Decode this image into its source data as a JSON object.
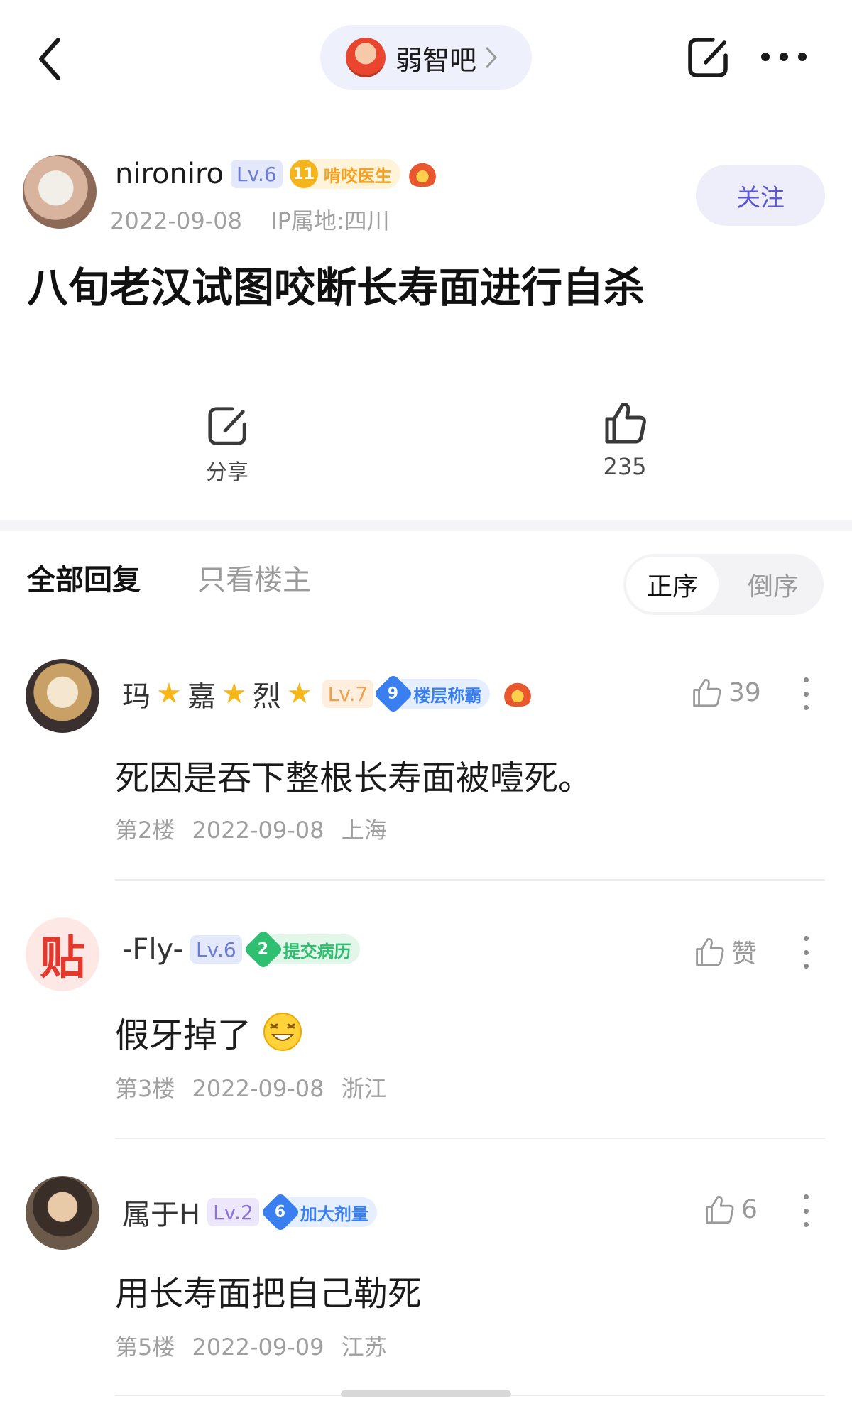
{
  "header": {
    "forum_name": "弱智吧"
  },
  "post": {
    "author": {
      "name": "nironiro",
      "level": "Lv.6",
      "title_badge_num": "11",
      "title_badge": "啃咬医生",
      "date": "2022-09-08",
      "ip_location": "IP属地:四川"
    },
    "follow_label": "关注",
    "title": "八旬老汉试图咬断长寿面进行自杀",
    "share_label": "分享",
    "like_count": "235"
  },
  "tabs": {
    "all_replies": "全部回复",
    "op_only": "只看楼主"
  },
  "sort": {
    "asc": "正序",
    "desc": "倒序"
  },
  "replies": [
    {
      "name": "玛",
      "name_part2": "嘉",
      "name_part3": "烈",
      "star_glyph": "★",
      "level": "Lv.7",
      "badge_num": "9",
      "badge": "楼层称霸",
      "likes": "39",
      "content": "死因是吞下整根长寿面被噎死。",
      "floor": "第2楼",
      "date": "2022-09-08",
      "location": "上海"
    },
    {
      "name": "-Fly-",
      "avatar_text": "贴",
      "level": "Lv.6",
      "badge_num": "2",
      "badge": "提交病历",
      "likes": "赞",
      "content": "假牙掉了",
      "floor": "第3楼",
      "date": "2022-09-08",
      "location": "浙江"
    },
    {
      "name": "属于H",
      "level": "Lv.2",
      "badge_num": "6",
      "badge": "加大剂量",
      "likes": "6",
      "content": "用长寿面把自己勒死",
      "floor": "第5楼",
      "date": "2022-09-09",
      "location": "江苏"
    }
  ],
  "colors": {
    "accent": "#5a58d4",
    "level_badge": "#6c7bd6",
    "gold_badge": "#f4a020",
    "blue_badge": "#3a7ff0",
    "green_badge": "#2fbf71"
  }
}
